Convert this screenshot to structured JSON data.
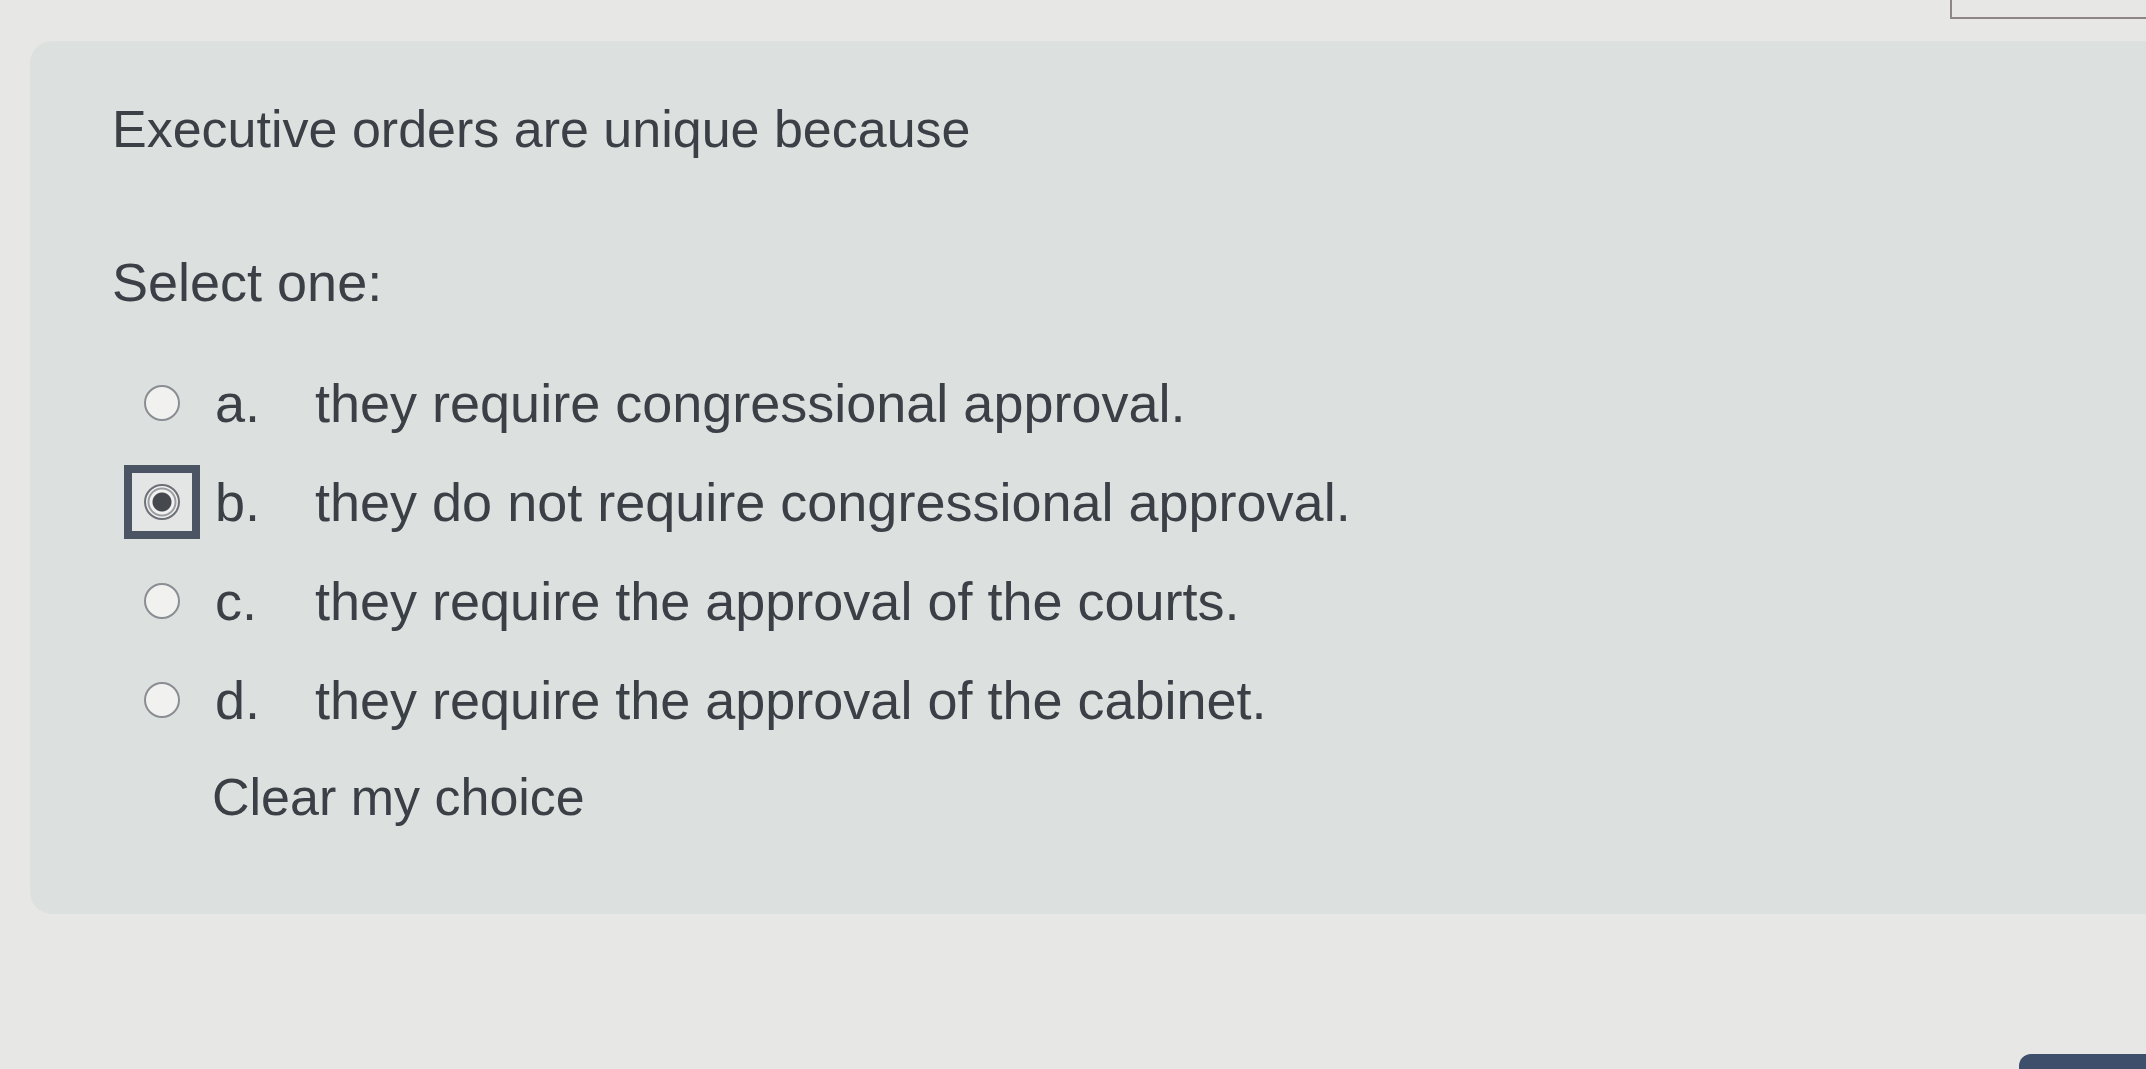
{
  "question": {
    "text": "Executive orders are unique because",
    "prompt": "Select one:"
  },
  "options": [
    {
      "letter": "a.",
      "text": "they require congressional approval.",
      "selected": false,
      "focused": false
    },
    {
      "letter": "b.",
      "text": "they do not require congressional approval.",
      "selected": true,
      "focused": true
    },
    {
      "letter": "c.",
      "text": "they require the approval of the courts.",
      "selected": false,
      "focused": false
    },
    {
      "letter": "d.",
      "text": "they require the approval of the cabinet.",
      "selected": false,
      "focused": false
    }
  ],
  "clear_link": "Clear my choice"
}
